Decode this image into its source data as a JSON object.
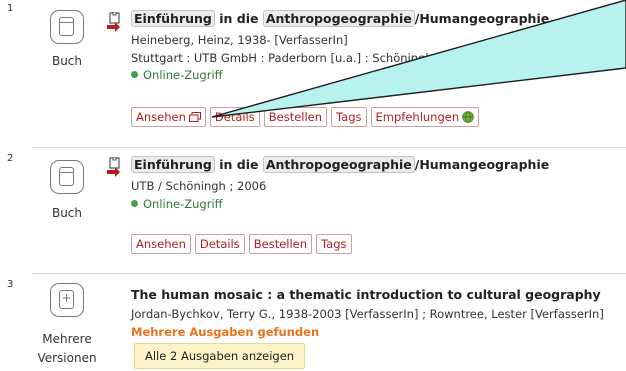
{
  "results": [
    {
      "number": "1",
      "media_type": "Buch",
      "title_parts": [
        "Einführung",
        "in die",
        "Anthropogeographie",
        "/Humangeographie"
      ],
      "author_line": "Heineberg, Heinz, 1938- [VerfasserIn]",
      "publisher_line": "Stuttgart : UTB GmbH : Paderborn [u.a.] : Schöningh",
      "online": "Online-Zugriff",
      "buttons": {
        "view": "Ansehen",
        "details": "Details",
        "order": "Bestellen",
        "tags": "Tags",
        "recommendations": "Empfehlungen"
      }
    },
    {
      "number": "2",
      "media_type": "Buch",
      "title_parts": [
        "Einführung",
        "in die",
        "Anthropogeographie",
        "/Humangeographie"
      ],
      "publisher_line": "UTB / Schöningh ; 2006",
      "online": "Online-Zugriff",
      "buttons": {
        "view": "Ansehen",
        "details": "Details",
        "order": "Bestellen",
        "tags": "Tags"
      }
    },
    {
      "number": "3",
      "media_type_1": "Mehrere",
      "media_type_2": "Versionen",
      "title": "The human mosaic : a thematic introduction to cultural geography",
      "author_line": "Jordan-Bychkov, Terry G., 1938-2003 [VerfasserIn] ; Rowntree, Lester [VerfasserIn]",
      "multi_editions": "Mehrere Ausgaben gefunden",
      "show_all": "Alle 2 Ausgaben anzeigen"
    }
  ],
  "colors": {
    "link_red": "#b71c1c",
    "online_green": "#2e7d32",
    "orange": "#e8721d",
    "callout_fill": "#b8f2ee"
  }
}
